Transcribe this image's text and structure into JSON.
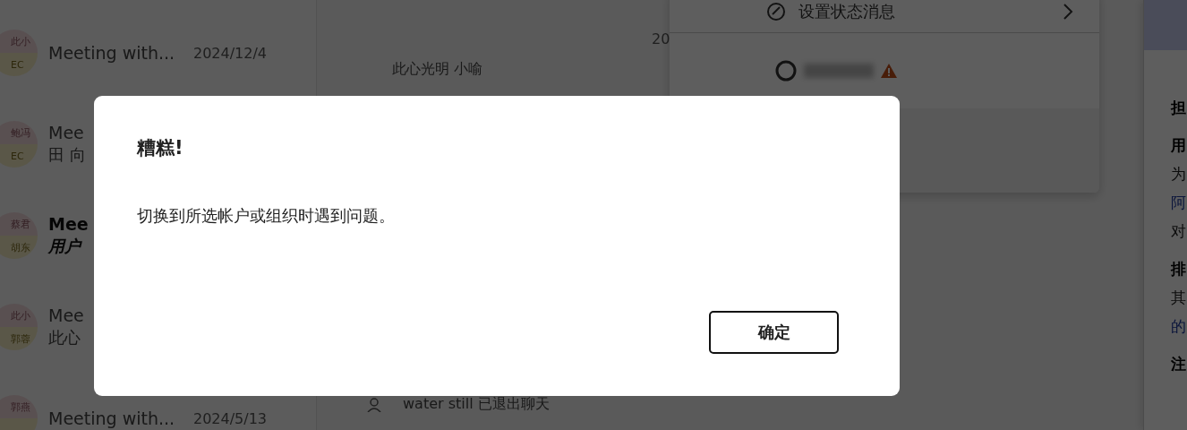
{
  "chat_list": [
    {
      "title": "Meeting with...",
      "date": "2024/12/4",
      "unread": false,
      "avatar": [
        "此小",
        "EC"
      ]
    },
    {
      "title": "Mee",
      "subtitle": "田 向",
      "unread": false,
      "avatar": [
        "鲍冯",
        "EC"
      ]
    },
    {
      "title": "Mee",
      "subtitle": "用户",
      "unread": true,
      "avatar": [
        "蔡君",
        "胡东"
      ]
    },
    {
      "title": "Mee",
      "subtitle": "此心",
      "unread": false,
      "avatar": [
        "此小",
        "郭蓉"
      ]
    },
    {
      "title": "Meeting with...",
      "date": "2024/5/13",
      "unread": false,
      "avatar": [
        "郭燕"
      ]
    }
  ],
  "conversation": {
    "date": "20",
    "sender": "此心光明 小喻",
    "event": "water still 已退出聊天"
  },
  "status_menu": {
    "item": "设置状态消息",
    "account_warning": true
  },
  "right_panel": [
    {
      "text": "担",
      "kind": "heading"
    },
    {
      "text": "用",
      "kind": "heading"
    },
    {
      "text": "为",
      "kind": "text"
    },
    {
      "text": "阿",
      "kind": "link"
    },
    {
      "text": "对",
      "kind": "text"
    },
    {
      "text": "排",
      "kind": "heading"
    },
    {
      "text": "其",
      "kind": "text"
    },
    {
      "text": "的",
      "kind": "link"
    },
    {
      "text": "注",
      "kind": "heading"
    }
  ],
  "dialog": {
    "title": "糟糕!",
    "message": "切换到所选帐户或组织时遇到问题。",
    "button": "确定"
  }
}
